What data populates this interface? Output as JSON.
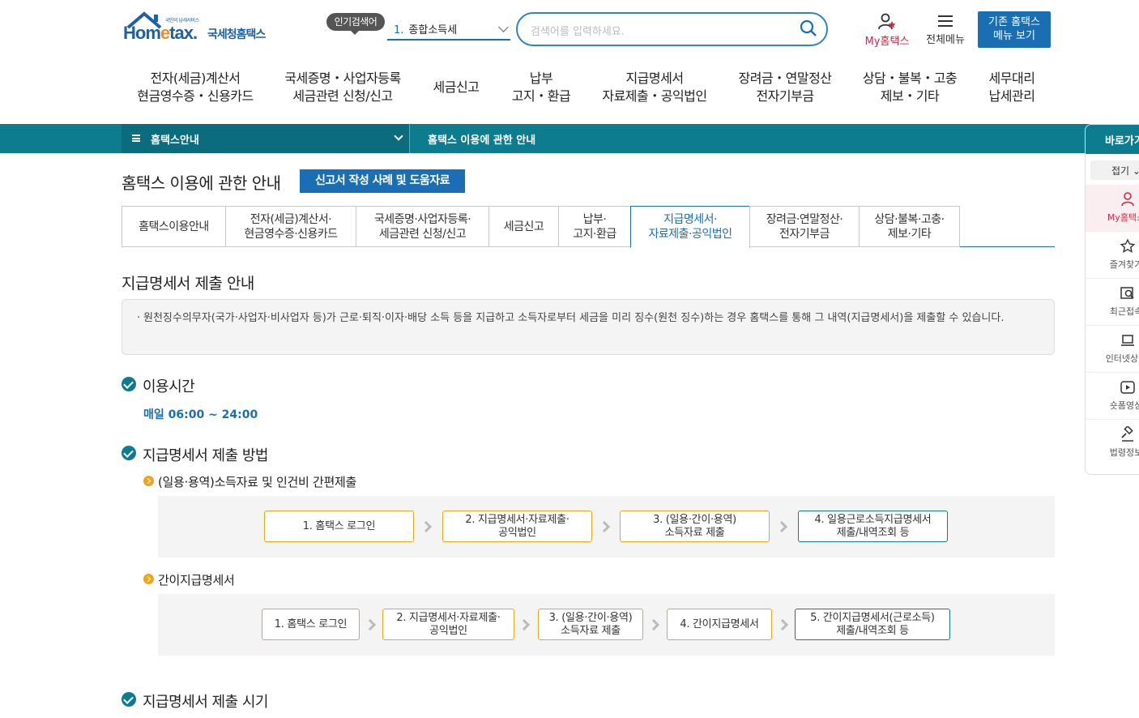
{
  "header": {
    "logo_brand_a": "Hom",
    "logo_brand_e": "e",
    "logo_brand_b": "tax.",
    "logo_sub": "국세청홈택스",
    "logo_tiny": "국민의 납세서비스",
    "popular_badge": "인기검색어",
    "popular_rank": "1.",
    "popular_term": "종합소득세",
    "search_placeholder": "검색어를 입력하세요.",
    "my_label": "My홈택스",
    "all_menu_label": "전체메뉴",
    "old_menu_label_1": "기존 홈택스",
    "old_menu_label_2": "메뉴 보기"
  },
  "nav": [
    "전자(세금)계산서\n현금영수증・신용카드",
    "국세증명・사업자등록\n세금관련 신청/신고",
    "세금신고",
    "납부\n고지・환급",
    "지급명세서\n자료제출・공익법인",
    "장려금・연말정산\n전자기부금",
    "상담・불복・고충\n제보・기타",
    "세무대리\n납세관리"
  ],
  "breadcrumb": {
    "menu": "홈택스안내",
    "current": "홈택스 이용에 관한 안내"
  },
  "quick": {
    "title": "바로가기",
    "fold": "접기",
    "items": [
      "My홈택스",
      "즐겨찾기",
      "최근접속",
      "인터넷상담",
      "숏폼영상",
      "법령정보"
    ]
  },
  "page": {
    "title": "홈택스 이용에 관한 안내",
    "help_button": "신고서 작성 사례 및 도움자료"
  },
  "tabs": [
    "홈택스이용안내",
    "전자(세금)계산서·\n현금영수증·신용카드",
    "국세증명·사업자등록·\n세금관련 신청/신고",
    "세금신고",
    "납부·\n고지·환급",
    "지급명세서·\n자료제출·공익법인",
    "장려금·연말정산·\n전자기부금",
    "상담·불복·고충·\n제보·기타"
  ],
  "content": {
    "section_title": "지급명세서 제출 안내",
    "notice": "원천징수의무자(국가·사업자·비사업자 등)가 근로·퇴직·이자·배당 소득 등을 지급하고 소득자로부터 세금을 미리 징수(원천 징수)하는 경우 홈택스를 통해 그 내역(지급명세서)을 제출할 수 있습니다.",
    "usage_time_title": "이용시간",
    "usage_time_value": "매일 06:00 ~ 24:00",
    "method_title": "지급명세서 제출 방법",
    "flow1_title": "(일용·용역)소득자료 및 인건비 간편제출",
    "flow1_steps": [
      "1. 홈택스 로그인",
      "2. 지급명세서·자료제출·\n공익법인",
      "3. (일용·간이·용역)\n소득자료 제출",
      "4. 일용근로소득지급명세서\n제출/내역조회 등"
    ],
    "flow2_title": "간이지급명세서",
    "flow2_steps": [
      "1. 홈택스 로그인",
      "2. 지급명세서·자료제출·\n공익법인",
      "3. (일용·간이·용역)\n소득자료 제출",
      "4. 간이지급명세서",
      "5. 간이지급명세서(근로소득)\n제출/내역조회 등"
    ],
    "timing_title": "지급명세서 제출 시기"
  }
}
